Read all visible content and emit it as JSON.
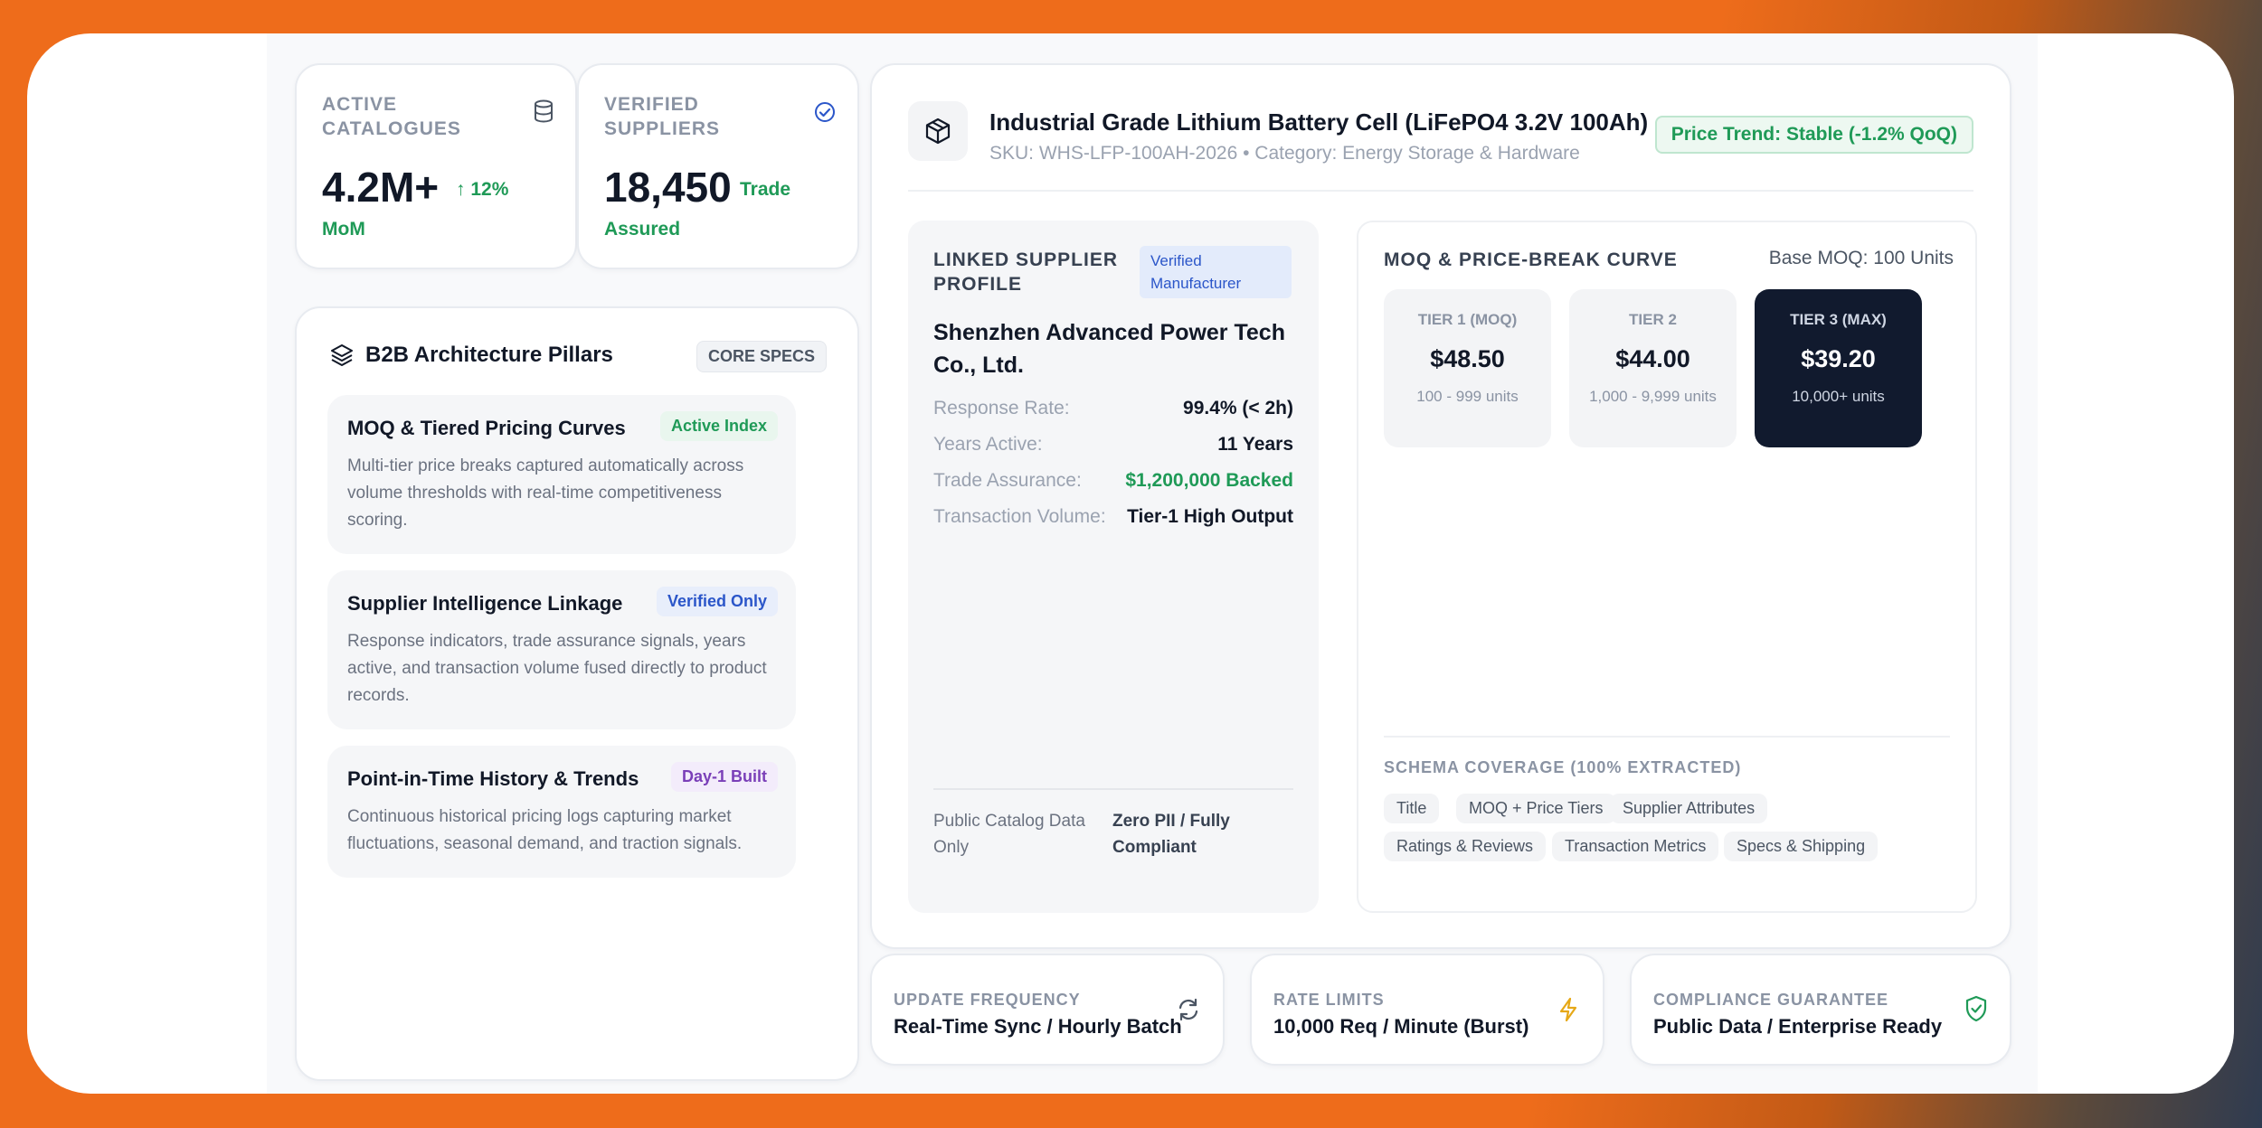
{
  "stats": {
    "catalogues": {
      "label": "ACTIVE CATALOGUES",
      "value": "4.2M+",
      "change": "↑ 12%",
      "change_suffix": "MoM",
      "icon": "database-icon"
    },
    "suppliers": {
      "label": "VERIFIED SUPPLIERS",
      "value": "18,450",
      "badge": "Trade",
      "badge_suffix": "Assured",
      "icon": "check-circle-icon"
    }
  },
  "pillars": {
    "title": "B2B Architecture Pillars",
    "tag": "CORE SPECS",
    "items": [
      {
        "title": "MOQ & Tiered Pricing Curves",
        "badge": "Active Index",
        "badge_color": "#1f9a57",
        "desc": "Multi-tier price breaks captured automatically across volume thresholds with real-time competitiveness scoring."
      },
      {
        "title": "Supplier Intelligence Linkage",
        "badge": "Verified Only",
        "badge_color": "#2b56c9",
        "desc": "Response indicators, trade assurance signals, years active, and transaction volume fused directly to product records."
      },
      {
        "title": "Point-in-Time History & Trends",
        "badge": "Day-1 Built",
        "badge_color": "#7a3fb8",
        "desc": "Continuous historical pricing logs capturing market fluctuations, seasonal demand, and traction signals."
      }
    ]
  },
  "product": {
    "title": "Industrial Grade Lithium Battery Cell (LiFePO4 3.2V 100Ah)",
    "sku_line": "SKU: WHS-LFP-100AH-2026 • Category: Energy Storage & Hardware",
    "trend": "Price Trend: Stable (-1.2% QoQ)"
  },
  "supplier": {
    "section_label": "LINKED SUPPLIER PROFILE",
    "badge": "Verified Manufacturer",
    "name": "Shenzhen Advanced Power Tech Co., Ltd.",
    "rows": [
      {
        "k": "Response Rate:",
        "v": "99.4% (< 2h)"
      },
      {
        "k": "Years Active:",
        "v": "11 Years"
      },
      {
        "k": "Trade Assurance:",
        "v": "$1,200,000 Backed"
      },
      {
        "k": "Transaction Volume:",
        "v": "Tier-1 High Output"
      }
    ],
    "footer_k": "Public Catalog Data Only",
    "footer_v": "Zero PII / Fully Compliant"
  },
  "moq": {
    "title": "MOQ & PRICE-BREAK CURVE",
    "base": "Base MOQ: 100 Units",
    "tiers": [
      {
        "name": "TIER 1 (MOQ)",
        "price": "$48.50",
        "units": "100 - 999 units"
      },
      {
        "name": "TIER 2",
        "price": "$44.00",
        "units": "1,000 - 9,999 units"
      },
      {
        "name": "TIER 3 (MAX)",
        "price": "$39.20",
        "units": "10,000+ units"
      }
    ],
    "schema_label": "SCHEMA COVERAGE (100% EXTRACTED)",
    "chips": [
      "Title",
      "MOQ + Price Tiers",
      "Supplier Attributes",
      "Ratings & Reviews",
      "Transaction Metrics",
      "Specs & Shipping"
    ]
  },
  "bottom": [
    {
      "label": "UPDATE FREQUENCY",
      "value": "Real-Time Sync / Hourly Batch",
      "icon": "refresh-icon"
    },
    {
      "label": "RATE LIMITS",
      "value": "10,000 Req / Minute (Burst)",
      "icon": "lightning-icon"
    },
    {
      "label": "COMPLIANCE GUARANTEE",
      "value": "Public Data / Enterprise Ready",
      "icon": "shield-check-icon"
    }
  ],
  "colors": {
    "accent_orange": "#ee6c1b",
    "green": "#1f9a57",
    "dark_tier": "#111a2e"
  }
}
